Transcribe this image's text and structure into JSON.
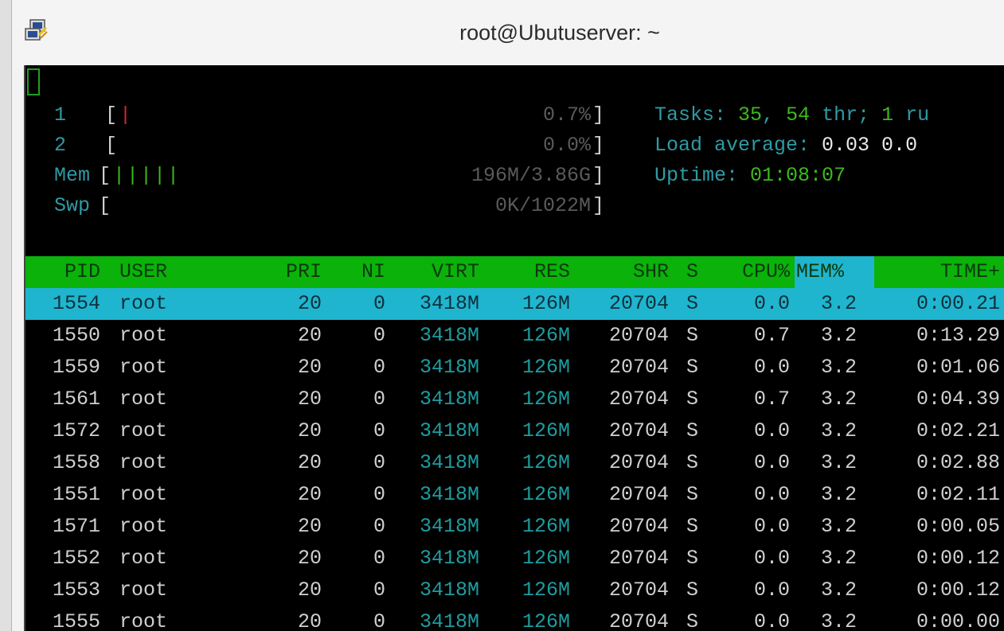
{
  "window": {
    "title": "root@Ubutuserver: ~",
    "icon": "putty-icon"
  },
  "meters": [
    {
      "label": "1",
      "bars": "|",
      "bar_color": "#d12a2a",
      "value": "0.7%"
    },
    {
      "label": "2",
      "bars": "",
      "bar_color": "#d12a2a",
      "value": "0.0%"
    },
    {
      "label": "Mem",
      "bars": "|||||",
      "bar_color": "#3cb81e",
      "value": "196M/3.86G"
    },
    {
      "label": "Swp",
      "bars": "",
      "bar_color": "#d12a2a",
      "value": "0K/1022M"
    }
  ],
  "info": {
    "tasks_label": "Tasks: ",
    "tasks_count": "35",
    "tasks_sep": ", ",
    "threads": "54",
    "thr_label": " thr; ",
    "running": "1",
    "running_label": " ru",
    "load_label": "Load average: ",
    "load_values": "0.03 0.0",
    "uptime_label": "Uptime: ",
    "uptime_value": "01:08:07"
  },
  "columns": {
    "pid": "PID",
    "user": "USER",
    "pri": "PRI",
    "ni": "NI",
    "virt": "VIRT",
    "res": "RES",
    "shr": "SHR",
    "s": "S",
    "cpu": "CPU%",
    "mem": "MEM%",
    "time": "TIME+"
  },
  "processes": [
    {
      "pid": "1554",
      "user": "root",
      "pri": "20",
      "ni": "0",
      "virt": "3418M",
      "res": "126M",
      "shr": "20704",
      "s": "S",
      "cpu": "0.0",
      "mem": "3.2",
      "time": "0:00.21"
    },
    {
      "pid": "1550",
      "user": "root",
      "pri": "20",
      "ni": "0",
      "virt": "3418M",
      "res": "126M",
      "shr": "20704",
      "s": "S",
      "cpu": "0.7",
      "mem": "3.2",
      "time": "0:13.29"
    },
    {
      "pid": "1559",
      "user": "root",
      "pri": "20",
      "ni": "0",
      "virt": "3418M",
      "res": "126M",
      "shr": "20704",
      "s": "S",
      "cpu": "0.0",
      "mem": "3.2",
      "time": "0:01.06"
    },
    {
      "pid": "1561",
      "user": "root",
      "pri": "20",
      "ni": "0",
      "virt": "3418M",
      "res": "126M",
      "shr": "20704",
      "s": "S",
      "cpu": "0.7",
      "mem": "3.2",
      "time": "0:04.39"
    },
    {
      "pid": "1572",
      "user": "root",
      "pri": "20",
      "ni": "0",
      "virt": "3418M",
      "res": "126M",
      "shr": "20704",
      "s": "S",
      "cpu": "0.0",
      "mem": "3.2",
      "time": "0:02.21"
    },
    {
      "pid": "1558",
      "user": "root",
      "pri": "20",
      "ni": "0",
      "virt": "3418M",
      "res": "126M",
      "shr": "20704",
      "s": "S",
      "cpu": "0.0",
      "mem": "3.2",
      "time": "0:02.88"
    },
    {
      "pid": "1551",
      "user": "root",
      "pri": "20",
      "ni": "0",
      "virt": "3418M",
      "res": "126M",
      "shr": "20704",
      "s": "S",
      "cpu": "0.0",
      "mem": "3.2",
      "time": "0:02.11"
    },
    {
      "pid": "1571",
      "user": "root",
      "pri": "20",
      "ni": "0",
      "virt": "3418M",
      "res": "126M",
      "shr": "20704",
      "s": "S",
      "cpu": "0.0",
      "mem": "3.2",
      "time": "0:00.05"
    },
    {
      "pid": "1552",
      "user": "root",
      "pri": "20",
      "ni": "0",
      "virt": "3418M",
      "res": "126M",
      "shr": "20704",
      "s": "S",
      "cpu": "0.0",
      "mem": "3.2",
      "time": "0:00.12"
    },
    {
      "pid": "1553",
      "user": "root",
      "pri": "20",
      "ni": "0",
      "virt": "3418M",
      "res": "126M",
      "shr": "20704",
      "s": "S",
      "cpu": "0.0",
      "mem": "3.2",
      "time": "0:00.12"
    },
    {
      "pid": "1555",
      "user": "root",
      "pri": "20",
      "ni": "0",
      "virt": "3418M",
      "res": "126M",
      "shr": "20704",
      "s": "S",
      "cpu": "0.0",
      "mem": "3.2",
      "time": "0:00.00"
    }
  ],
  "selected_index": 0
}
